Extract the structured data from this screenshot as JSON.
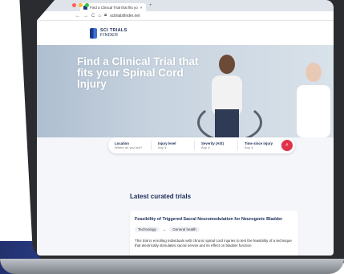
{
  "browser": {
    "tab_title": "Find a Clinical Trial that fits yo",
    "url": "scitrialsfinder.net",
    "traffic_lights": [
      "#ff5f57",
      "#febc2e",
      "#28c840"
    ]
  },
  "site": {
    "logo_line1": "SCI TRIALS",
    "logo_line2": "FINDER"
  },
  "hero": {
    "title": "Find a Clinical Trial that fits your Spinal Cord Injury"
  },
  "search": {
    "fields": [
      {
        "label": "Location",
        "value": "Where do you live?"
      },
      {
        "label": "Injury level",
        "value": "Any ∨"
      },
      {
        "label": "Severity (AIS)",
        "value": "Any ∨"
      },
      {
        "label": "Time since injury",
        "value": "Any ∨"
      }
    ],
    "button_icon": "search-icon"
  },
  "latest": {
    "heading": "Latest curated trials",
    "card": {
      "title": "Feasibility of Triggered Sacral Neuromodulation for Neurogenic Bladder",
      "tag1": "Technology",
      "arrow": "→",
      "tag2": "General health",
      "desc": "This trial is enrolling individuals with chronic spinal cord injuries to test the feasibility of a technique that electrically stimulates sacral nerves and its effect on bladder function"
    }
  },
  "colors": {
    "accent": "#e0334a",
    "brand": "#1a3c8c"
  }
}
